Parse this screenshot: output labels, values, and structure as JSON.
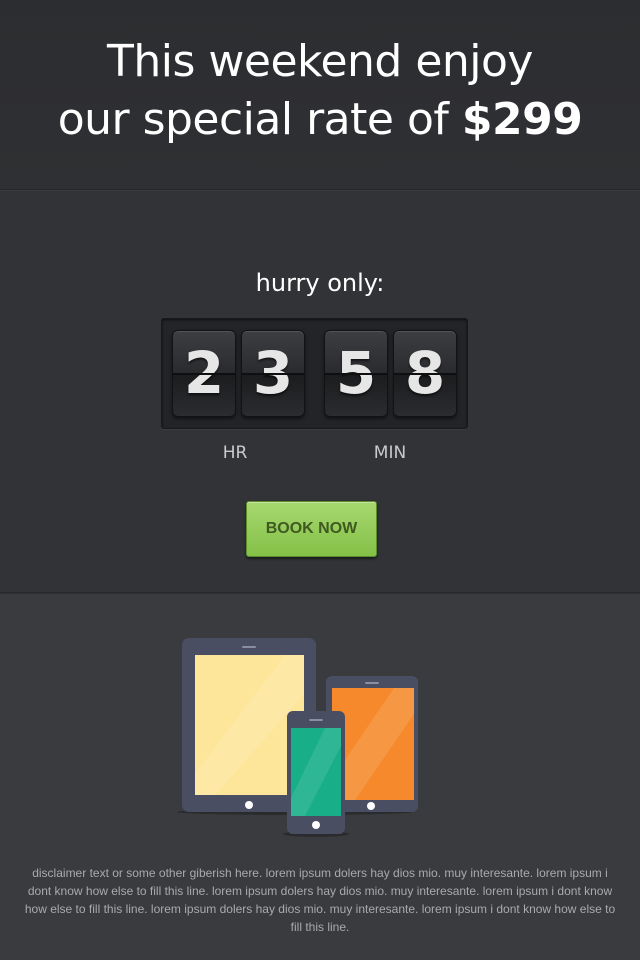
{
  "header": {
    "line1": "This weekend enjoy",
    "line2_prefix": "our special rate of ",
    "price": "$299"
  },
  "countdown": {
    "label": "hurry only:",
    "digits": [
      "2",
      "3",
      "5",
      "8"
    ],
    "hours_label": "HR",
    "minutes_label": "MIN"
  },
  "cta": {
    "label": "BOOK NOW",
    "color": "#9fd266"
  },
  "devices": {
    "tablet_screen_color": "#fde59a",
    "mini_tablet_screen_color": "#f5892b",
    "phone_screen_color": "#18ae88",
    "device_body_color": "#4a4e63"
  },
  "disclaimer": {
    "text": "disclaimer text or some other giberish here. lorem ipsum dolers hay dios mio. muy interesante. lorem ipsum i dont know how else to fill this line.  lorem ipsum dolers hay dios mio. muy interesante. lorem ipsum i dont know how else to fill this line.  lorem ipsum dolers hay dios  mio. muy interesante. lorem ipsum i dont know how else to fill this line."
  }
}
